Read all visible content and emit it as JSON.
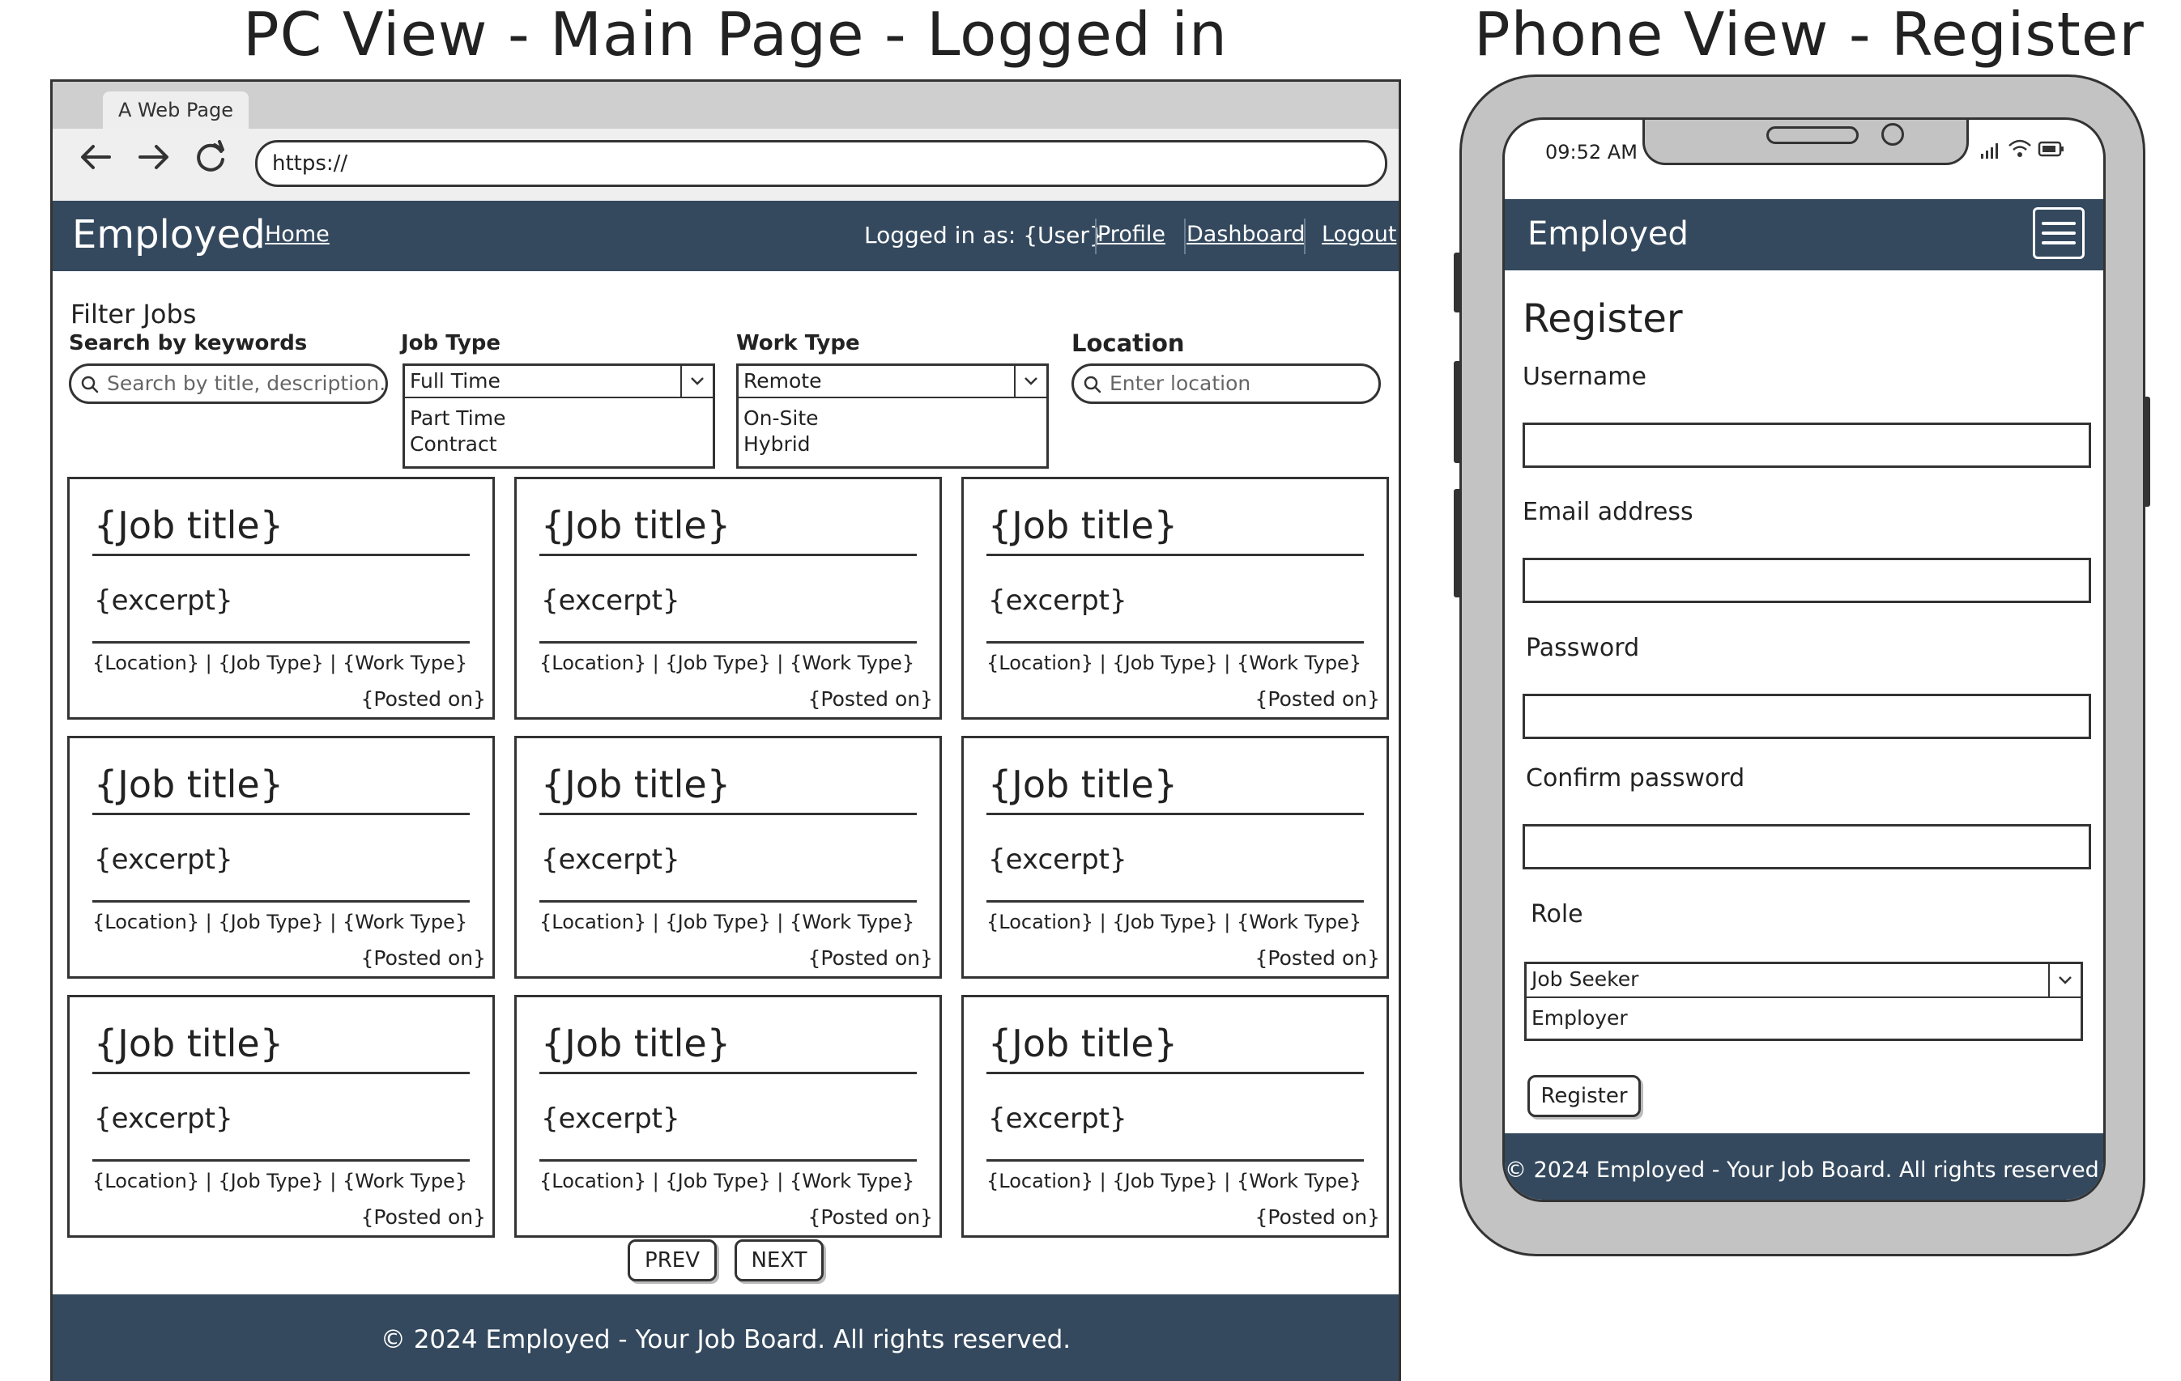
{
  "headings": {
    "pc": "PC View - Main Page - Logged in",
    "phone": "Phone View - Register"
  },
  "pc": {
    "tab_label": "A Web Page",
    "url": "https://",
    "navbar": {
      "brand": "Employed",
      "home": "Home",
      "logged_in": "Logged in as: {User}",
      "profile": "Profile",
      "dashboard": "Dashboard",
      "logout": "Logout"
    },
    "filter": {
      "heading": "Filter Jobs",
      "keywords_label": "Search by keywords",
      "keywords_placeholder": "Search by title, description...",
      "job_type_label": "Job Type",
      "job_type_selected": "Full Time",
      "job_type_options": [
        "Part Time",
        "Contract"
      ],
      "work_type_label": "Work Type",
      "work_type_selected": "Remote",
      "work_type_options": [
        "On-Site",
        "Hybrid"
      ],
      "location_label": "Location",
      "location_placeholder": "Enter location"
    },
    "job_cards": [
      {
        "title": "{Job title}",
        "excerpt": "{excerpt}",
        "meta": "{Location} | {Job Type} | {Work Type}",
        "posted": "{Posted on}"
      },
      {
        "title": "{Job title}",
        "excerpt": "{excerpt}",
        "meta": "{Location} | {Job Type} | {Work Type}",
        "posted": "{Posted on}"
      },
      {
        "title": "{Job title}",
        "excerpt": "{excerpt}",
        "meta": "{Location} | {Job Type} | {Work Type}",
        "posted": "{Posted on}"
      },
      {
        "title": "{Job title}",
        "excerpt": "{excerpt}",
        "meta": "{Location} | {Job Type} | {Work Type}",
        "posted": "{Posted on}"
      },
      {
        "title": "{Job title}",
        "excerpt": "{excerpt}",
        "meta": "{Location} | {Job Type} | {Work Type}",
        "posted": "{Posted on}"
      },
      {
        "title": "{Job title}",
        "excerpt": "{excerpt}",
        "meta": "{Location} | {Job Type} | {Work Type}",
        "posted": "{Posted on}"
      },
      {
        "title": "{Job title}",
        "excerpt": "{excerpt}",
        "meta": "{Location} | {Job Type} | {Work Type}",
        "posted": "{Posted on}"
      },
      {
        "title": "{Job title}",
        "excerpt": "{excerpt}",
        "meta": "{Location} | {Job Type} | {Work Type}",
        "posted": "{Posted on}"
      },
      {
        "title": "{Job title}",
        "excerpt": "{excerpt}",
        "meta": "{Location} | {Job Type} | {Work Type}",
        "posted": "{Posted on}"
      }
    ],
    "pagination": {
      "prev": "PREV",
      "next": "NEXT"
    },
    "footer": "© 2024 Employed - Your Job Board. All rights reserved."
  },
  "phone": {
    "time": "09:52 AM",
    "navbar": {
      "brand": "Employed"
    },
    "form": {
      "heading": "Register",
      "username_label": "Username",
      "email_label": "Email address",
      "password_label": "Password",
      "confirm_label": "Confirm password",
      "role_label": "Role",
      "role_selected": "Job Seeker",
      "role_options": [
        "Employer"
      ],
      "submit": "Register"
    },
    "footer": "© 2024 Employed - Your Job Board. All rights reserved."
  },
  "colors": {
    "navbar": "#34495e",
    "chrome": "#cfcfcf",
    "phone_body": "#c3c3c3"
  },
  "icons": [
    "back-arrow-icon",
    "forward-arrow-icon",
    "reload-icon",
    "search-icon",
    "chevron-down-icon",
    "hamburger-menu-icon",
    "signal-icon",
    "wifi-icon",
    "battery-icon"
  ]
}
